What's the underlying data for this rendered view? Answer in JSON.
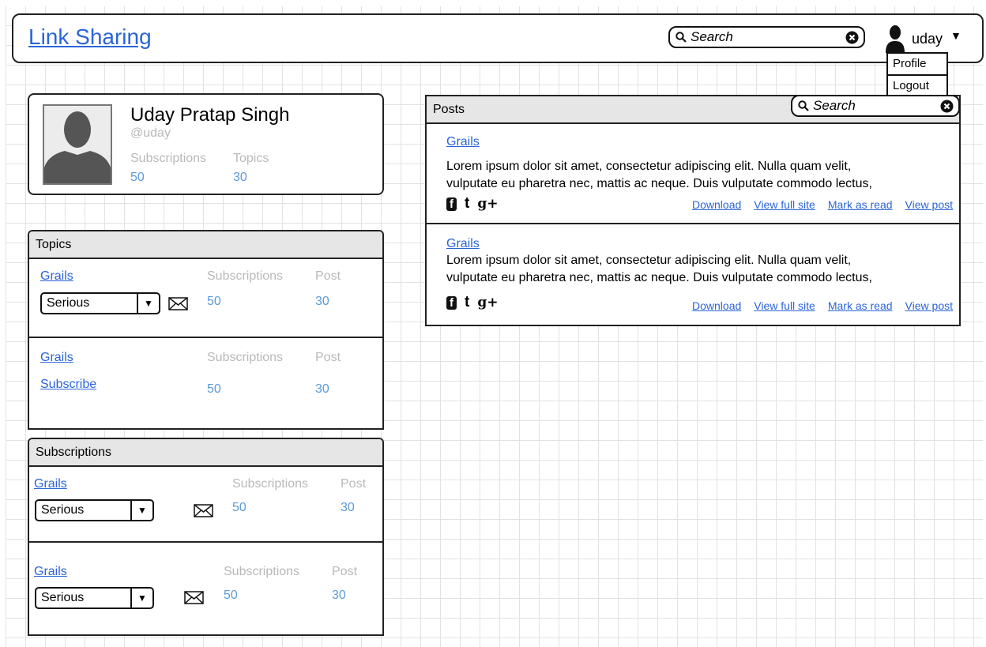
{
  "header": {
    "title": "Link Sharing",
    "search_placeholder": "Search",
    "user": "uday",
    "menu": [
      "Profile",
      "Logout"
    ]
  },
  "profile": {
    "name": "Uday Pratap Singh",
    "handle": "@uday",
    "subscriptions_label": "Subscriptions",
    "topics_label": "Topics",
    "subscriptions": "50",
    "topics": "30"
  },
  "topics": {
    "heading": "Topics",
    "rows": [
      {
        "name": "Grails",
        "subs_label": "Subscriptions",
        "post_label": "Post",
        "subs": "50",
        "posts": "30",
        "seriousness": "Serious"
      },
      {
        "name": "Grails",
        "subs_label": "Subscriptions",
        "post_label": "Post",
        "subs": "50",
        "posts": "30",
        "action": "Subscribe"
      }
    ]
  },
  "subscriptions": {
    "heading": "Subscriptions",
    "rows": [
      {
        "name": "Grails",
        "subs_label": "Subscriptions",
        "post_label": "Post",
        "subs": "50",
        "posts": "30",
        "seriousness": "Serious"
      },
      {
        "name": "Grails",
        "subs_label": "Subscriptions",
        "post_label": "Post",
        "subs": "50",
        "posts": "30",
        "seriousness": "Serious"
      }
    ]
  },
  "posts": {
    "heading": "Posts",
    "search_placeholder": "Search",
    "items": [
      {
        "topic": "Grails",
        "line1": "Lorem ipsum dolor sit amet, consectetur adipiscing elit. Nulla quam velit,",
        "line2": "vulputate eu pharetra nec, mattis ac neque. Duis vulputate commodo lectus,",
        "actions": [
          "Download",
          "View full site",
          "Mark as read",
          "View post"
        ]
      },
      {
        "topic": "Grails",
        "line1": "Lorem ipsum dolor sit amet, consectetur adipiscing elit. Nulla quam velit,",
        "line2": "vulputate eu pharetra nec, mattis ac neque. Duis vulputate commodo lectus,",
        "actions": [
          "Download",
          "View full site",
          "Mark as read",
          "View post"
        ]
      }
    ],
    "social": {
      "facebook": "f",
      "twitter": "t",
      "google": "g+"
    }
  }
}
